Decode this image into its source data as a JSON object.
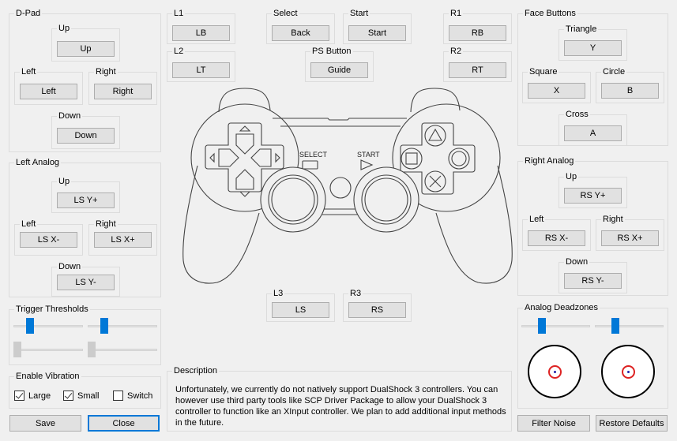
{
  "dpad": {
    "title": "D-Pad",
    "up": {
      "label": "Up",
      "value": "Up"
    },
    "left": {
      "label": "Left",
      "value": "Left"
    },
    "right": {
      "label": "Right",
      "value": "Right"
    },
    "down": {
      "label": "Down",
      "value": "Down"
    }
  },
  "left_analog": {
    "title": "Left Analog",
    "up": {
      "label": "Up",
      "value": "LS Y+"
    },
    "left": {
      "label": "Left",
      "value": "LS X-"
    },
    "right": {
      "label": "Right",
      "value": "LS X+"
    },
    "down": {
      "label": "Down",
      "value": "LS Y-"
    }
  },
  "trigger_thresholds": {
    "title": "Trigger Thresholds",
    "sliders": [
      {
        "name": "left-trigger",
        "value_fraction": 0.15,
        "enabled": true
      },
      {
        "name": "right-trigger",
        "value_fraction": 0.15,
        "enabled": true
      },
      {
        "name": "left-trigger-2",
        "value_fraction": 0.0,
        "enabled": false
      },
      {
        "name": "right-trigger-2",
        "value_fraction": 0.0,
        "enabled": false
      }
    ]
  },
  "vibration": {
    "title": "Enable Vibration",
    "options": [
      {
        "label": "Large",
        "checked": true
      },
      {
        "label": "Small",
        "checked": true
      },
      {
        "label": "Switch",
        "checked": false
      }
    ]
  },
  "footer_left": {
    "save": "Save",
    "close": "Close"
  },
  "shoulders": {
    "l1": {
      "label": "L1",
      "value": "LB"
    },
    "l2": {
      "label": "L2",
      "value": "LT"
    },
    "r1": {
      "label": "R1",
      "value": "RB"
    },
    "r2": {
      "label": "R2",
      "value": "RT"
    }
  },
  "center": {
    "select": {
      "label": "Select",
      "value": "Back"
    },
    "start": {
      "label": "Start",
      "value": "Start"
    },
    "ps": {
      "label": "PS Button",
      "value": "Guide"
    },
    "l3": {
      "label": "L3",
      "value": "LS"
    },
    "r3": {
      "label": "R3",
      "value": "RS"
    }
  },
  "controller_image": {
    "select_text": "SELECT",
    "start_text": "START"
  },
  "description": {
    "title": "Description",
    "text": "Unfortunately, we currently do not natively support DualShock 3 controllers. You can however use third party tools like SCP Driver Package to allow your DualShock 3 controller to function like an XInput controller. We plan to add additional input methods in the future."
  },
  "face_buttons": {
    "title": "Face Buttons",
    "triangle": {
      "label": "Triangle",
      "value": "Y"
    },
    "square": {
      "label": "Square",
      "value": "X"
    },
    "circle": {
      "label": "Circle",
      "value": "B"
    },
    "cross": {
      "label": "Cross",
      "value": "A"
    }
  },
  "right_analog": {
    "title": "Right Analog",
    "up": {
      "label": "Up",
      "value": "RS Y+"
    },
    "left": {
      "label": "Left",
      "value": "RS X-"
    },
    "right": {
      "label": "Right",
      "value": "RS X+"
    },
    "down": {
      "label": "Down",
      "value": "RS Y-"
    }
  },
  "deadzones": {
    "title": "Analog Deadzones",
    "left_value_fraction": 0.22,
    "right_value_fraction": 0.22
  },
  "footer_right": {
    "filter_noise": "Filter Noise",
    "restore_defaults": "Restore Defaults"
  },
  "colors": {
    "accent": "#0078d7",
    "deadzone_ring": "#dd2222",
    "stick_dot": "#2222aa"
  }
}
